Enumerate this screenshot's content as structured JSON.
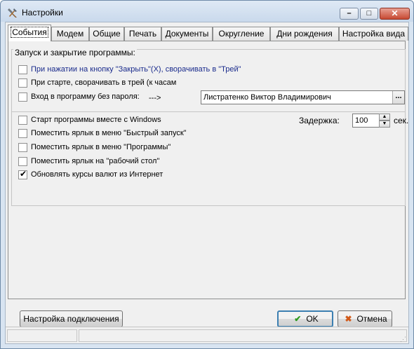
{
  "window": {
    "title": "Настройки"
  },
  "titlebar": {
    "minimize": "–",
    "maximize": "□",
    "close": "✕"
  },
  "tabs": [
    {
      "label": "События",
      "active": true
    },
    {
      "label": "Модем"
    },
    {
      "label": "Общие"
    },
    {
      "label": "Печать"
    },
    {
      "label": "Документы"
    },
    {
      "label": "Округление"
    },
    {
      "label": "Дни рождения"
    },
    {
      "label": "Настройка вида"
    }
  ],
  "events": {
    "group_title": "Запуск и закрытие программы:",
    "opt_minimize_close": {
      "label": "При нажатии на кнопку \"Закрыть\"(X), сворачивать в \"Трей\"",
      "checked": false
    },
    "opt_minimize_start": {
      "label": "При старте, сворачивать в трей (к часам",
      "checked": false
    },
    "opt_no_password": {
      "label": "Вход в программу без пароля:",
      "checked": false
    },
    "arrow": "--->",
    "user_value": "Листратенко Виктор Владимирович",
    "browse": "...",
    "opt_autostart": {
      "label": "Старт программы вместе с Windows",
      "checked": false
    },
    "delay_label": "Задержка:",
    "delay_value": "100",
    "delay_unit": "сек.",
    "opt_quicklaunch": {
      "label": "Поместить ярлык в меню \"Быстрый запуск\"",
      "checked": false
    },
    "opt_programs": {
      "label": "Поместить ярлык в меню \"Программы\"",
      "checked": false
    },
    "opt_desktop": {
      "label": "Поместить ярлык на \"рабочий стол\"",
      "checked": false
    },
    "opt_rates": {
      "label": "Обновлять курсы валют из Интернет",
      "checked": true
    }
  },
  "footer": {
    "connection_label": "Настройка подключения",
    "ok_label": "OK",
    "cancel_label": "Отмена"
  },
  "colors": {
    "accent_blue": "#1a2b8c",
    "ok_check": "#2e9a1e",
    "cancel_x": "#d15a1a"
  },
  "icons": {
    "app": "wrench-hammer-icon",
    "ok": "check-icon",
    "cancel": "x-icon"
  }
}
